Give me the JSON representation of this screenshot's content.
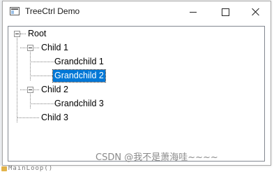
{
  "window": {
    "title": "TreeCtrl Demo"
  },
  "tree": {
    "nodes": [
      {
        "label": "Root",
        "expanded": true
      },
      {
        "label": "Child 1",
        "expanded": true
      },
      {
        "label": "Grandchild 1"
      },
      {
        "label": "Grandchild 2",
        "selected": true
      },
      {
        "label": "Child 2",
        "expanded": true
      },
      {
        "label": "Grandchild 3"
      },
      {
        "label": "Child 3"
      }
    ]
  },
  "watermark": "CSDN @我不是萧海哇~~~~",
  "background": {
    "bottom_text": "MainLoop()"
  },
  "colors": {
    "selection": "#0078d7",
    "selection_text": "#ffffff"
  }
}
